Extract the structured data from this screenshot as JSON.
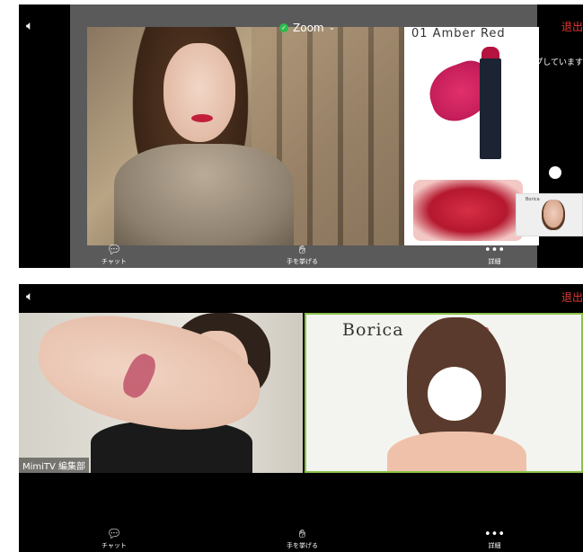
{
  "top": {
    "zoom_label": "Zoom",
    "leave_label": "退出",
    "product_label": "01 Amber Red",
    "side_text": "プしています",
    "thumb_brand": "Borica",
    "toolbar": {
      "chat": "チャット",
      "raise_hand": "手を挙げる",
      "more": "詳細"
    }
  },
  "bottom": {
    "leave_label": "退出",
    "participant_name": "MimiTV 編集部",
    "brand": "Borica",
    "toolbar": {
      "chat": "チャット",
      "raise_hand": "手を挙げる",
      "more": "詳細"
    }
  },
  "icons": {
    "speaker": "speaker-icon",
    "chat": "chat-icon",
    "hand": "raise-hand-icon",
    "more": "more-icon"
  },
  "colors": {
    "leave": "#e53935",
    "active_speaker_border": "#8bc34a",
    "zoom_check": "#2bbd4c"
  }
}
